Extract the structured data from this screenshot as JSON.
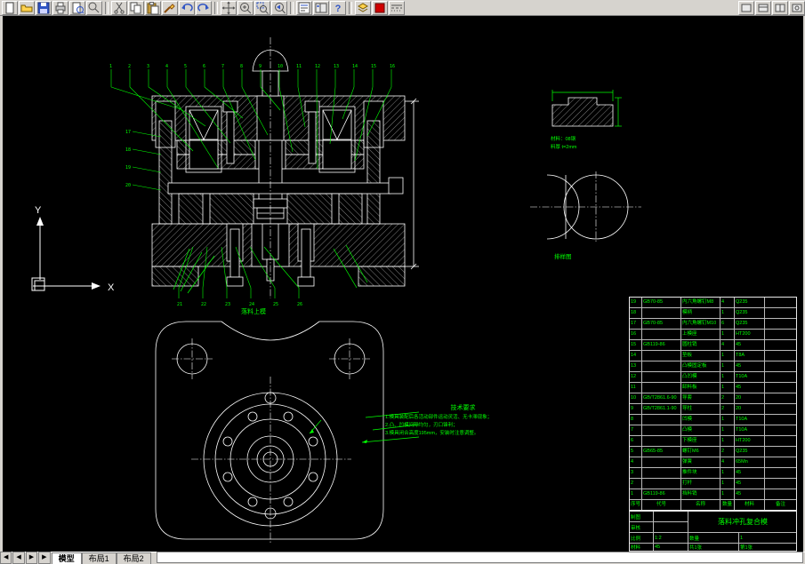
{
  "toolbar": {
    "icons": [
      "new-file",
      "open-file",
      "save",
      "print",
      "print-preview",
      "find",
      "cut",
      "copy",
      "paste",
      "match-properties",
      "undo",
      "redo",
      "pan",
      "zoom-realtime",
      "zoom-window",
      "zoom-previous",
      "properties",
      "design-center",
      "help",
      "layers",
      "color-control",
      "linetype",
      "lineweight"
    ]
  },
  "tabs": {
    "nav": [
      "◀",
      "◀",
      "▶",
      "▶"
    ],
    "items": [
      "模型",
      "布局1",
      "布局2"
    ]
  },
  "drawing": {
    "ucs": {
      "x": "X",
      "y": "Y"
    },
    "plate_view_title": "落料上模",
    "strip_label": "排样图",
    "part_notes": [
      "材料：08钢",
      "料厚 t=2mm"
    ],
    "tech_requirements": {
      "title": "技术要求",
      "lines": [
        "1.模具装配后各活动部件运动灵活、无卡滞现象；",
        "2.凸、凹模间隙均匀，刃口锋利；",
        "3.模具闭合高度195mm，安装时注意调整。"
      ]
    },
    "callouts": {
      "top": [
        "1",
        "2",
        "3",
        "4",
        "5",
        "6",
        "7",
        "8",
        "9",
        "10",
        "11",
        "12",
        "13",
        "14",
        "15",
        "16"
      ],
      "left": [
        "17",
        "18",
        "19",
        "20"
      ],
      "bottom": [
        "21",
        "22",
        "23",
        "24",
        "25",
        "26"
      ]
    }
  },
  "parts_table": {
    "header": [
      "序号",
      "代号",
      "名称",
      "数量",
      "材料",
      "备注"
    ],
    "rows": [
      {
        "no": "19",
        "code": "GB70-85",
        "name": "内六角螺钉M8",
        "qty": "4",
        "mat": "Q235",
        "note": ""
      },
      {
        "no": "18",
        "code": "",
        "name": "模柄",
        "qty": "1",
        "mat": "Q235",
        "note": ""
      },
      {
        "no": "17",
        "code": "GB70-85",
        "name": "内六角螺钉M10",
        "qty": "6",
        "mat": "Q235",
        "note": ""
      },
      {
        "no": "16",
        "code": "",
        "name": "上模座",
        "qty": "1",
        "mat": "HT200",
        "note": ""
      },
      {
        "no": "15",
        "code": "GB119-86",
        "name": "圆柱销",
        "qty": "4",
        "mat": "45",
        "note": ""
      },
      {
        "no": "14",
        "code": "",
        "name": "垫板",
        "qty": "1",
        "mat": "T8A",
        "note": ""
      },
      {
        "no": "13",
        "code": "",
        "name": "凸模固定板",
        "qty": "1",
        "mat": "45",
        "note": ""
      },
      {
        "no": "12",
        "code": "",
        "name": "凸凹模",
        "qty": "1",
        "mat": "T10A",
        "note": ""
      },
      {
        "no": "11",
        "code": "",
        "name": "卸料板",
        "qty": "1",
        "mat": "45",
        "note": ""
      },
      {
        "no": "10",
        "code": "GB/T2861.6-90",
        "name": "导套",
        "qty": "2",
        "mat": "20",
        "note": ""
      },
      {
        "no": "9",
        "code": "GB/T2861.1-90",
        "name": "导柱",
        "qty": "2",
        "mat": "20",
        "note": ""
      },
      {
        "no": "8",
        "code": "",
        "name": "凹模",
        "qty": "1",
        "mat": "T10A",
        "note": ""
      },
      {
        "no": "7",
        "code": "",
        "name": "凸模",
        "qty": "1",
        "mat": "T10A",
        "note": ""
      },
      {
        "no": "6",
        "code": "",
        "name": "下模座",
        "qty": "1",
        "mat": "HT200",
        "note": ""
      },
      {
        "no": "5",
        "code": "GB65-85",
        "name": "螺钉M6",
        "qty": "2",
        "mat": "Q235",
        "note": ""
      },
      {
        "no": "4",
        "code": "",
        "name": "弹簧",
        "qty": "4",
        "mat": "65Mn",
        "note": ""
      },
      {
        "no": "3",
        "code": "",
        "name": "推件块",
        "qty": "1",
        "mat": "45",
        "note": ""
      },
      {
        "no": "2",
        "code": "",
        "name": "打杆",
        "qty": "1",
        "mat": "45",
        "note": ""
      },
      {
        "no": "1",
        "code": "GB119-86",
        "name": "挡料销",
        "qty": "1",
        "mat": "45",
        "note": ""
      }
    ]
  },
  "title_block": {
    "draw_label": "制图",
    "check_label": "审核",
    "scale_label": "比例",
    "scale": "1:2",
    "qty_label": "数量",
    "qty": "1",
    "mat_label": "材料",
    "mat": "45",
    "sheets": "共1张",
    "sheet_no": "第1张",
    "title": "落料冲孔复合模"
  }
}
